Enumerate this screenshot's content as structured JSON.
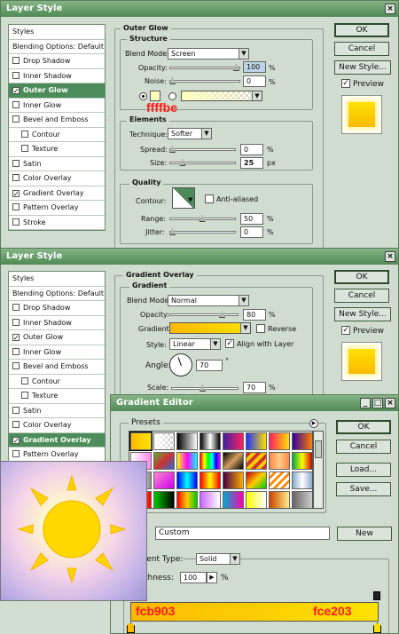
{
  "dialog1": {
    "title": "Layer Style",
    "close": "×",
    "styles_header": "Styles",
    "styles": [
      {
        "label": "Blending Options: Default",
        "checked": null,
        "selected": false,
        "indent": false
      },
      {
        "label": "Drop Shadow",
        "checked": false,
        "selected": false,
        "indent": false
      },
      {
        "label": "Inner Shadow",
        "checked": false,
        "selected": false,
        "indent": false
      },
      {
        "label": "Outer Glow",
        "checked": true,
        "selected": true,
        "indent": false
      },
      {
        "label": "Inner Glow",
        "checked": false,
        "selected": false,
        "indent": false
      },
      {
        "label": "Bevel and Emboss",
        "checked": false,
        "selected": false,
        "indent": false
      },
      {
        "label": "Contour",
        "checked": false,
        "selected": false,
        "indent": true
      },
      {
        "label": "Texture",
        "checked": false,
        "selected": false,
        "indent": true
      },
      {
        "label": "Satin",
        "checked": false,
        "selected": false,
        "indent": false
      },
      {
        "label": "Color Overlay",
        "checked": false,
        "selected": false,
        "indent": false
      },
      {
        "label": "Gradient Overlay",
        "checked": true,
        "selected": false,
        "indent": false
      },
      {
        "label": "Pattern Overlay",
        "checked": false,
        "selected": false,
        "indent": false
      },
      {
        "label": "Stroke",
        "checked": false,
        "selected": false,
        "indent": false
      }
    ],
    "section_title": "Outer Glow",
    "structure": {
      "title": "Structure",
      "blend_mode_label": "Blend Mode:",
      "blend_mode": "Screen",
      "opacity_label": "Opacity:",
      "opacity": "100",
      "opacity_level": 1.0,
      "noise_label": "Noise:",
      "noise": "0",
      "noise_level": 0.0,
      "unit": "%"
    },
    "color_note": "ffffbe",
    "elements": {
      "title": "Elements",
      "technique_label": "Technique:",
      "technique": "Softer",
      "spread_label": "Spread:",
      "spread": "0",
      "spread_level": 0.0,
      "size_label": "Size:",
      "size": "25",
      "size_level": 0.17,
      "px": "px",
      "pct": "%"
    },
    "quality": {
      "title": "Quality",
      "contour_label": "Contour:",
      "antialiased_label": "Anti-aliased",
      "range_label": "Range:",
      "range": "50",
      "range_level": 0.5,
      "jitter_label": "Jitter:",
      "jitter": "0",
      "jitter_level": 0.0,
      "pct": "%"
    },
    "buttons": {
      "ok": "OK",
      "cancel": "Cancel",
      "new_style": "New Style...",
      "preview": "Preview"
    }
  },
  "dialog2": {
    "title": "Layer Style",
    "close": "×",
    "styles_header": "Styles",
    "styles": [
      {
        "label": "Blending Options: Default",
        "checked": null,
        "selected": false,
        "indent": false
      },
      {
        "label": "Drop Shadow",
        "checked": false,
        "selected": false,
        "indent": false
      },
      {
        "label": "Inner Shadow",
        "checked": false,
        "selected": false,
        "indent": false
      },
      {
        "label": "Outer Glow",
        "checked": true,
        "selected": false,
        "indent": false
      },
      {
        "label": "Inner Glow",
        "checked": false,
        "selected": false,
        "indent": false
      },
      {
        "label": "Bevel and Emboss",
        "checked": false,
        "selected": false,
        "indent": false
      },
      {
        "label": "Contour",
        "checked": false,
        "selected": false,
        "indent": true
      },
      {
        "label": "Texture",
        "checked": false,
        "selected": false,
        "indent": true
      },
      {
        "label": "Satin",
        "checked": false,
        "selected": false,
        "indent": false
      },
      {
        "label": "Color Overlay",
        "checked": false,
        "selected": false,
        "indent": false
      },
      {
        "label": "Gradient Overlay",
        "checked": true,
        "selected": true,
        "indent": false
      },
      {
        "label": "Pattern Overlay",
        "checked": false,
        "selected": false,
        "indent": false
      }
    ],
    "section_title": "Gradient Overlay",
    "gradient": {
      "title": "Gradient",
      "blend_mode_label": "Blend Mode:",
      "blend_mode": "Normal",
      "opacity_label": "Opacity:",
      "opacity": "80",
      "opacity_level": 0.8,
      "gradient_label": "Gradient:",
      "reverse_label": "Reverse",
      "style_label": "Style:",
      "style": "Linear",
      "align_label": "Align with Layer",
      "angle_label": "Angle:",
      "angle": "70",
      "deg": "°",
      "scale_label": "Scale:",
      "scale": "70",
      "scale_level": 0.47,
      "pct": "%"
    },
    "buttons": {
      "ok": "OK",
      "cancel": "Cancel",
      "new_style": "New Style...",
      "preview": "Preview"
    }
  },
  "gradient_editor": {
    "title": "Gradient Editor",
    "presets_label": "Presets",
    "name_value": "Custom",
    "new_button": "New",
    "type_label": "dient Type:",
    "type_value": "Solid",
    "smooth_label": "thness:",
    "smooth_value": "100",
    "pct": "%",
    "buttons": {
      "ok": "OK",
      "cancel": "Cancel",
      "load": "Load...",
      "save": "Save..."
    },
    "color_left": "fcb903",
    "color_right": "fce203"
  },
  "colors": {
    "glow": "#ffffbe",
    "grad_left": "#fcb903",
    "grad_right": "#fce203",
    "accent": "#4c8c5a",
    "note": "#ff1a1a"
  }
}
